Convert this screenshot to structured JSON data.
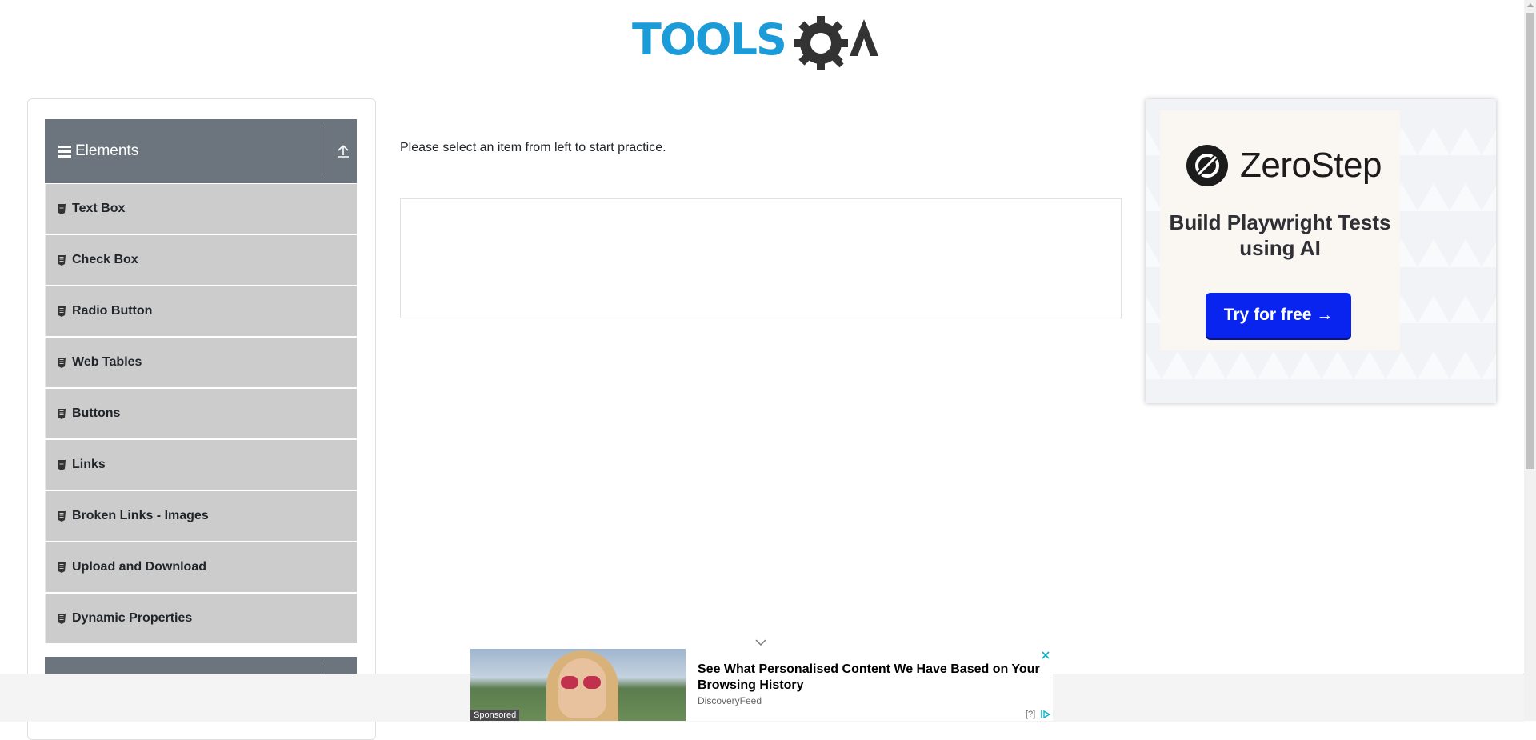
{
  "header": {
    "logo_text": "TOOLSQA"
  },
  "sidebar": {
    "group": {
      "label": "Elements"
    },
    "items": [
      {
        "label": "Text Box"
      },
      {
        "label": "Check Box"
      },
      {
        "label": "Radio Button"
      },
      {
        "label": "Web Tables"
      },
      {
        "label": "Buttons"
      },
      {
        "label": "Links"
      },
      {
        "label": "Broken Links - Images"
      },
      {
        "label": "Upload and Download"
      },
      {
        "label": "Dynamic Properties"
      }
    ]
  },
  "main": {
    "intro_text": "Please select an item from left to start practice."
  },
  "ad_right": {
    "brand": "ZeroStep",
    "tagline": "Build Playwright Tests using AI",
    "cta": "Try for free →"
  },
  "ad_bottom": {
    "headline": "See What Personalised Content We Have Based on Your Browsing History",
    "source": "DiscoveryFeed",
    "sponsored": "Sponsored",
    "info": "[?]"
  },
  "colors": {
    "brand_blue": "#1b9bd7",
    "brand_dark": "#333333",
    "group_header": "#6c757d",
    "menu_item": "#cccccc",
    "cta_blue": "#0a24f0"
  }
}
